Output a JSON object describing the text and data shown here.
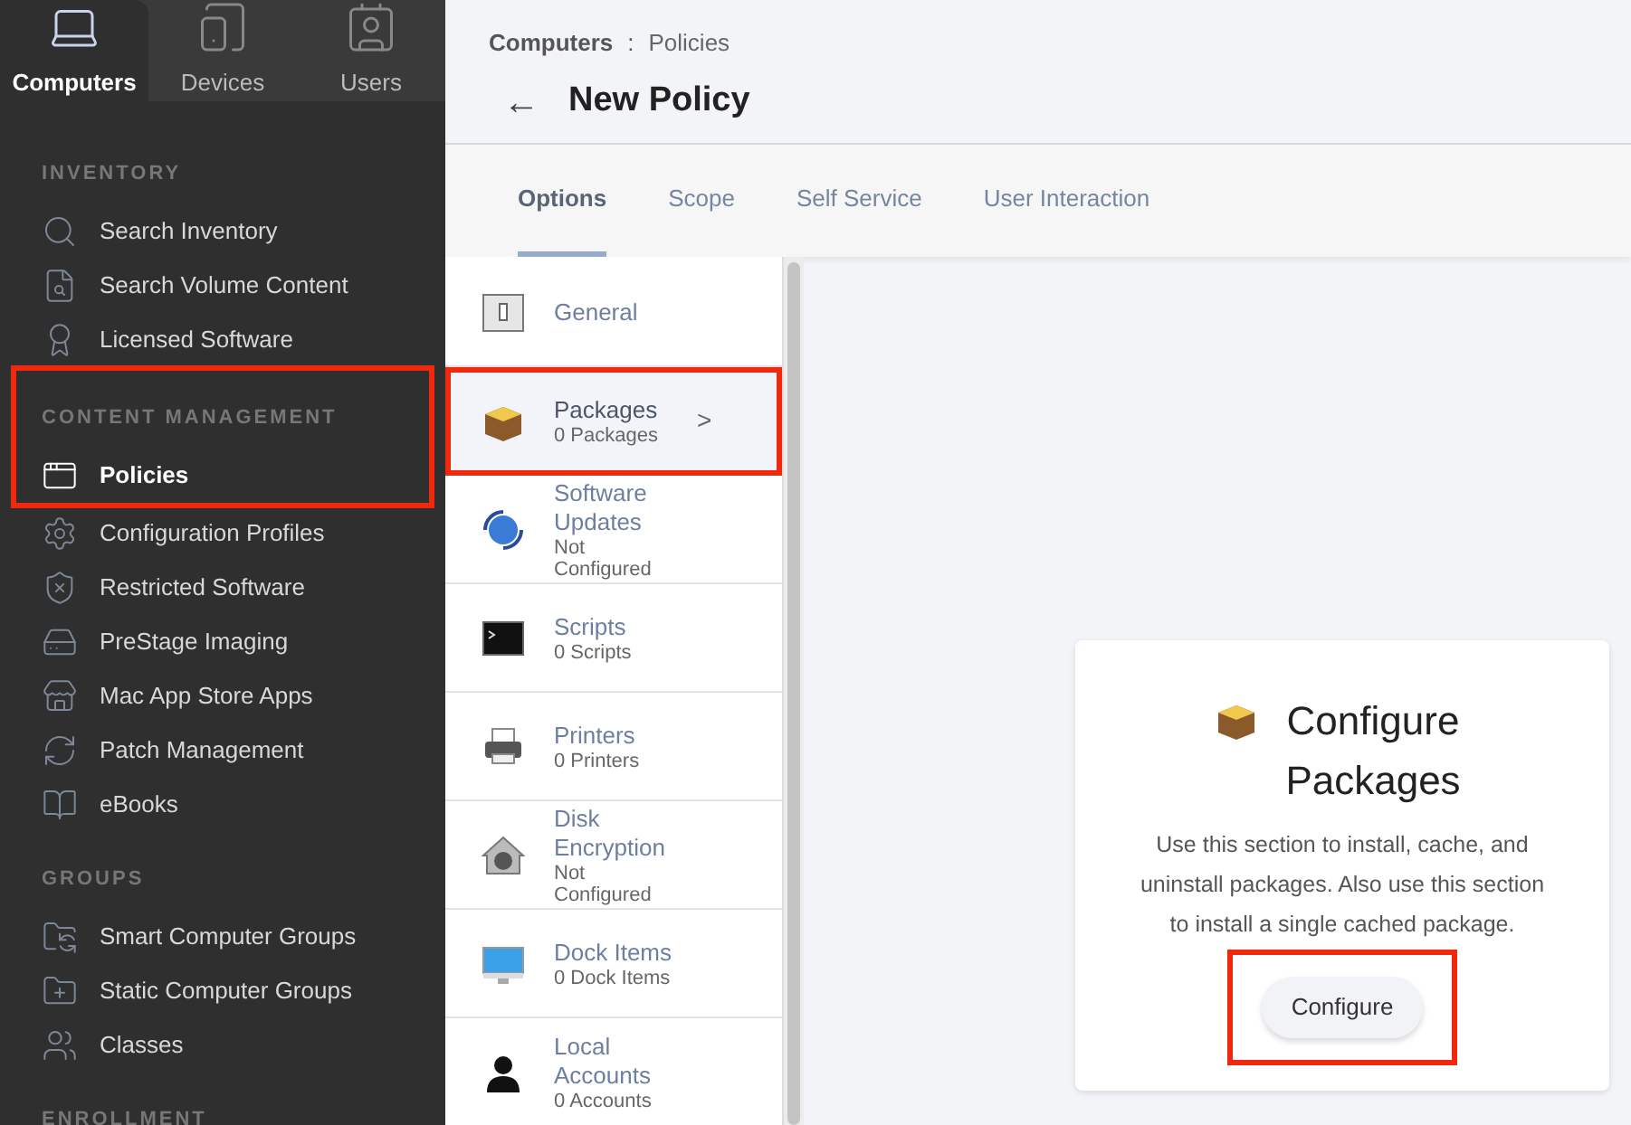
{
  "top_tabs": [
    {
      "label": "Computers",
      "selected": true
    },
    {
      "label": "Devices",
      "selected": false
    },
    {
      "label": "Users",
      "selected": false
    }
  ],
  "sidebar": [
    {
      "kind": "heading",
      "label": "INVENTORY",
      "highlighted": false
    },
    {
      "kind": "item",
      "label": "Search Inventory",
      "selected": false,
      "highlighted": false
    },
    {
      "kind": "item",
      "label": "Search Volume Content",
      "selected": false,
      "highlighted": false
    },
    {
      "kind": "item",
      "label": "Licensed Software",
      "selected": false,
      "highlighted": false
    },
    {
      "kind": "heading",
      "label": "CONTENT MANAGEMENT",
      "highlighted": true
    },
    {
      "kind": "item",
      "label": "Policies",
      "selected": true,
      "highlighted": true
    },
    {
      "kind": "item",
      "label": "Configuration Profiles",
      "selected": false,
      "highlighted": false
    },
    {
      "kind": "item",
      "label": "Restricted Software",
      "selected": false,
      "highlighted": false
    },
    {
      "kind": "item",
      "label": "PreStage Imaging",
      "selected": false,
      "highlighted": false
    },
    {
      "kind": "item",
      "label": "Mac App Store Apps",
      "selected": false,
      "highlighted": false
    },
    {
      "kind": "item",
      "label": "Patch Management",
      "selected": false,
      "highlighted": false
    },
    {
      "kind": "item",
      "label": "eBooks",
      "selected": false,
      "highlighted": false
    },
    {
      "kind": "heading",
      "label": "GROUPS",
      "highlighted": false
    },
    {
      "kind": "item",
      "label": "Smart Computer Groups",
      "selected": false,
      "highlighted": false
    },
    {
      "kind": "item",
      "label": "Static Computer Groups",
      "selected": false,
      "highlighted": false
    },
    {
      "kind": "item",
      "label": "Classes",
      "selected": false,
      "highlighted": false
    },
    {
      "kind": "heading",
      "label": "ENROLLMENT",
      "highlighted": false
    }
  ],
  "breadcrumb": {
    "parent": "Computers",
    "separator": ":",
    "current": "Policies"
  },
  "page_title": {
    "back": "←",
    "title": "New Policy"
  },
  "tabs": [
    {
      "label": "Options",
      "selected": true
    },
    {
      "label": "Scope",
      "selected": false
    },
    {
      "label": "Self Service",
      "selected": false
    },
    {
      "label": "User Interaction",
      "selected": false
    }
  ],
  "options": [
    {
      "title": "General",
      "selected": false,
      "highlighted": false
    },
    {
      "title": "Packages",
      "subtitle": "0 Packages",
      "selected": true,
      "highlighted": true,
      "chevron": ">"
    },
    {
      "title": "Software Updates",
      "subtitle": "Not Configured",
      "selected": false,
      "highlighted": false
    },
    {
      "title": "Scripts",
      "subtitle": "0 Scripts",
      "selected": false,
      "highlighted": false
    },
    {
      "title": "Printers",
      "subtitle": "0 Printers",
      "selected": false,
      "highlighted": false
    },
    {
      "title": "Disk Encryption",
      "subtitle": "Not Configured",
      "selected": false,
      "highlighted": false
    },
    {
      "title": "Dock Items",
      "subtitle": "0 Dock Items",
      "selected": false,
      "highlighted": false
    },
    {
      "title": "Local Accounts",
      "subtitle": "0 Accounts",
      "selected": false,
      "highlighted": false
    }
  ],
  "card": {
    "title": "Configure Packages",
    "text": "Use this section to install, cache, and uninstall packages. Also use this section to install a single cached package.",
    "button": "Configure",
    "button_highlighted": true
  }
}
